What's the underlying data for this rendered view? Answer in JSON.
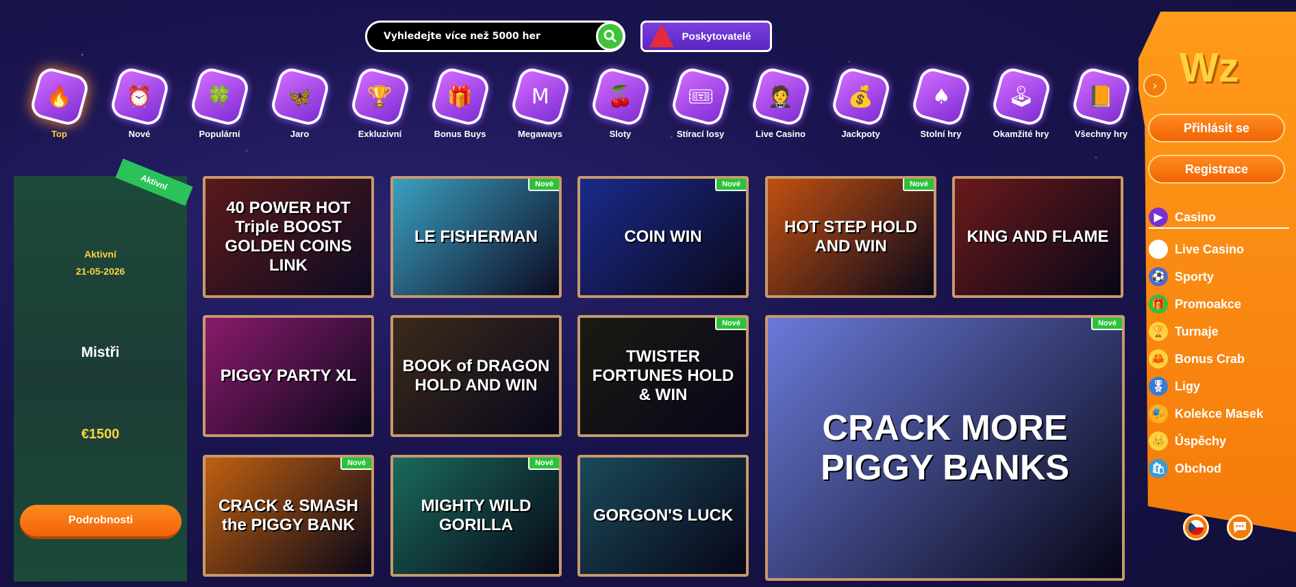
{
  "search": {
    "placeholder": "Vyhledejte více než 5000 her"
  },
  "providers_label": "Poskytovatelé",
  "categories": [
    {
      "label": "Top",
      "icon": "flame-icon",
      "glyph": "🔥"
    },
    {
      "label": "Nové",
      "icon": "alarm-clock-icon",
      "glyph": "⏰"
    },
    {
      "label": "Populární",
      "icon": "clover-icon",
      "glyph": "🍀"
    },
    {
      "label": "Jaro",
      "icon": "butterfly-icon",
      "glyph": "🦋"
    },
    {
      "label": "Exkluzivní",
      "icon": "trophy-icon",
      "glyph": "🏆"
    },
    {
      "label": "Bonus Buys",
      "icon": "gift-icon",
      "glyph": "🎁"
    },
    {
      "label": "Megaways",
      "icon": "m-icon",
      "glyph": "M"
    },
    {
      "label": "Sloty",
      "icon": "cherry-icon",
      "glyph": "🍒"
    },
    {
      "label": "Stírací losy",
      "icon": "scratch-card-icon",
      "glyph": "🎟"
    },
    {
      "label": "Live Casino",
      "icon": "dealer-icon",
      "glyph": "🤵"
    },
    {
      "label": "Jackpoty",
      "icon": "money-bag-icon",
      "glyph": "💰"
    },
    {
      "label": "Stolní hry",
      "icon": "spade-card-icon",
      "glyph": "♠"
    },
    {
      "label": "Okamžité hry",
      "icon": "joystick-icon",
      "glyph": "🕹"
    },
    {
      "label": "Všechny hry",
      "icon": "book-icon",
      "glyph": "📙"
    }
  ],
  "promo": {
    "badge": "Aktivní",
    "status": "Aktivní",
    "date": "21-05-2026",
    "name": "Mistři",
    "prize": "€1500",
    "button": "Podrobnosti"
  },
  "games": [
    {
      "title": "40 POWER HOT Triple BOOST GOLDEN COINS LINK",
      "new": false
    },
    {
      "title": "LE FISHERMAN",
      "new": true
    },
    {
      "title": "COIN WIN",
      "new": true
    },
    {
      "title": "HOT STEP HOLD AND WIN",
      "new": true
    },
    {
      "title": "KING AND FLAME",
      "new": false
    },
    {
      "title": "PIGGY PARTY XL",
      "new": false
    },
    {
      "title": "BOOK of DRAGON HOLD AND WIN",
      "new": false
    },
    {
      "title": "TWISTER FORTUNES HOLD & WIN",
      "new": true
    },
    {
      "title": "CRACK MORE PIGGY BANKS",
      "new": true
    },
    {
      "title": "CRACK & SMASH the PIGGY BANK",
      "new": true
    },
    {
      "title": "MIGHTY WILD GORILLA",
      "new": true
    },
    {
      "title": "GORGON'S LUCK",
      "new": false
    }
  ],
  "new_badge": "Nové",
  "sidebar": {
    "logo": "Wz",
    "login": "Přihlásit se",
    "register": "Registrace",
    "nav": [
      {
        "label": "Casino",
        "icon": "play-icon",
        "glyph": "▶",
        "color": "#7a2fd4"
      },
      {
        "label": "Live Casino",
        "icon": "card-icon",
        "glyph": "♠",
        "color": "#ffffff"
      },
      {
        "label": "Sporty",
        "icon": "soccer-ball-icon",
        "glyph": "⚽",
        "color": "#4a6bd8"
      },
      {
        "label": "Promoakce",
        "icon": "gift-icon",
        "glyph": "🎁",
        "color": "#2bc23a"
      },
      {
        "label": "Turnaje",
        "icon": "trophy-icon",
        "glyph": "🏆",
        "color": "#ffd23f"
      },
      {
        "label": "Bonus Crab",
        "icon": "crab-icon",
        "glyph": "🦀",
        "color": "#ffd23f"
      },
      {
        "label": "Ligy",
        "icon": "league-icon",
        "glyph": "🎖",
        "color": "#3a7bd5"
      },
      {
        "label": "Kolekce Masek",
        "icon": "mask-icon",
        "glyph": "🎭",
        "color": "#ffb020"
      },
      {
        "label": "Úspěchy",
        "icon": "crown-icon",
        "glyph": "👑",
        "color": "#ffd23f"
      },
      {
        "label": "Obchod",
        "icon": "shop-icon",
        "glyph": "🛍",
        "color": "#3a9bd5"
      }
    ]
  }
}
